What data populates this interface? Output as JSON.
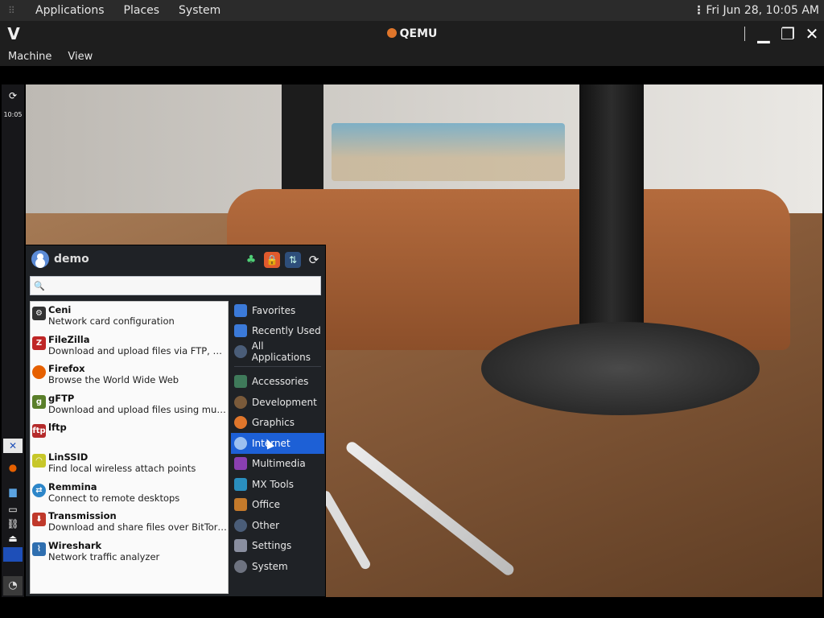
{
  "host_panel": {
    "menus": [
      "Applications",
      "Places",
      "System"
    ],
    "clock": "Fri Jun 28, 10:05 AM"
  },
  "qemu": {
    "title": "QEMU",
    "menus": [
      "Machine",
      "View"
    ]
  },
  "guest_panel": {
    "time": "10:05"
  },
  "whisker": {
    "user": "demo",
    "search": {
      "value": "",
      "placeholder": ""
    },
    "apps": [
      {
        "name": "Ceni",
        "desc": "Network card configuration",
        "icon": "network-icon",
        "color": "#333333"
      },
      {
        "name": "FileZilla",
        "desc": "Download and upload files via FTP, FTPS...",
        "icon": "filezilla-icon",
        "color": "#bf2626"
      },
      {
        "name": "Firefox",
        "desc": "Browse the World Wide Web",
        "icon": "firefox-icon",
        "color": "#e66000"
      },
      {
        "name": "gFTP",
        "desc": "Download and upload files using multi...",
        "icon": "gftp-icon",
        "color": "#5a7f2a"
      },
      {
        "name": "lftp",
        "desc": "",
        "icon": "lftp-icon",
        "color": "#b52b2b"
      },
      {
        "name": "LinSSID",
        "desc": "Find local wireless attach points",
        "icon": "wifi-icon",
        "color": "#c7c72a"
      },
      {
        "name": "Remmina",
        "desc": "Connect to remote desktops",
        "icon": "remmina-icon",
        "color": "#2d86c9"
      },
      {
        "name": "Transmission",
        "desc": "Download and share files over BitTorrent",
        "icon": "transmission-icon",
        "color": "#c0392b"
      },
      {
        "name": "Wireshark",
        "desc": "Network traffic analyzer",
        "icon": "wireshark-icon",
        "color": "#2f6fb0"
      }
    ],
    "categories_top": [
      {
        "label": "Favorites",
        "color": "#3b7ad9"
      },
      {
        "label": "Recently Used",
        "color": "#3b7ad9"
      },
      {
        "label": "All Applications",
        "color": "#4a5d78"
      }
    ],
    "categories": [
      {
        "label": "Accessories",
        "color": "#3f7a5a"
      },
      {
        "label": "Development",
        "color": "#7a5a3a"
      },
      {
        "label": "Graphics",
        "color": "#e0762b"
      },
      {
        "label": "Internet",
        "color": "#3b7ad9",
        "selected": true
      },
      {
        "label": "Multimedia",
        "color": "#8a3fb0"
      },
      {
        "label": "MX Tools",
        "color": "#2a8fbf"
      },
      {
        "label": "Office",
        "color": "#c47a2b"
      },
      {
        "label": "Other",
        "color": "#4a5d78"
      },
      {
        "label": "Settings",
        "color": "#8a8fa0"
      },
      {
        "label": "System",
        "color": "#6e7380"
      }
    ]
  }
}
